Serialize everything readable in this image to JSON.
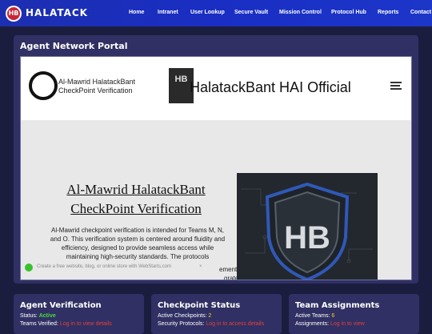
{
  "brand": {
    "name": "HALATACK",
    "badge": "HB"
  },
  "nav": {
    "items": [
      "Home",
      "Intranet",
      "User Lookup",
      "Secure Vault",
      "Mission Control",
      "Protocol Hub",
      "Reports",
      "Contact"
    ]
  },
  "portal": {
    "title": "Agent Network Portal"
  },
  "site": {
    "header_line1": "Al-Mawrid HalatackBant",
    "header_line2": "CheckPoint Verification",
    "thumb_text": "HB",
    "official": "HalatackBant HAI Official",
    "heading_line1": "Al-Mawrid HalatackBant",
    "heading_line2": "CheckPoint Verification",
    "paragraph": "Al-Mawrid checkpoint verification is intended for Teams M, N, and O. This verification system is centered around fluidity and efficiency, designed to provide seamless access while maintaining high-security standards. The protocols",
    "para_extra1": "ements",
    "para_extra2": "grated",
    "image_text": "HB",
    "footer_text": "Create a free website, blog, or online store with WebStarts.com",
    "footer_close": "×"
  },
  "cards": [
    {
      "title": "Agent Verification",
      "line1_label": "Status: ",
      "line1_value": "Active",
      "line2_label": "Teams Verified: ",
      "line2_value": "Log in to view details"
    },
    {
      "title": "Checkpoint Status",
      "line1_label": "Active Checkpoints: ",
      "line1_value": "2",
      "line2_label": "Security Protocols: ",
      "line2_value": "Log in to access details"
    },
    {
      "title": "Team Assignments",
      "line1_label": "Active Teams: ",
      "line1_value": "6",
      "line2_label": "Assignments: ",
      "line2_value": "Log in to view"
    }
  ],
  "colors": {
    "nav_bg": "#1c2fb0",
    "page_bg": "#1b1d3e",
    "panel_bg": "#303064",
    "status_green": "#4ade3a",
    "link_red": "#e5413c"
  }
}
